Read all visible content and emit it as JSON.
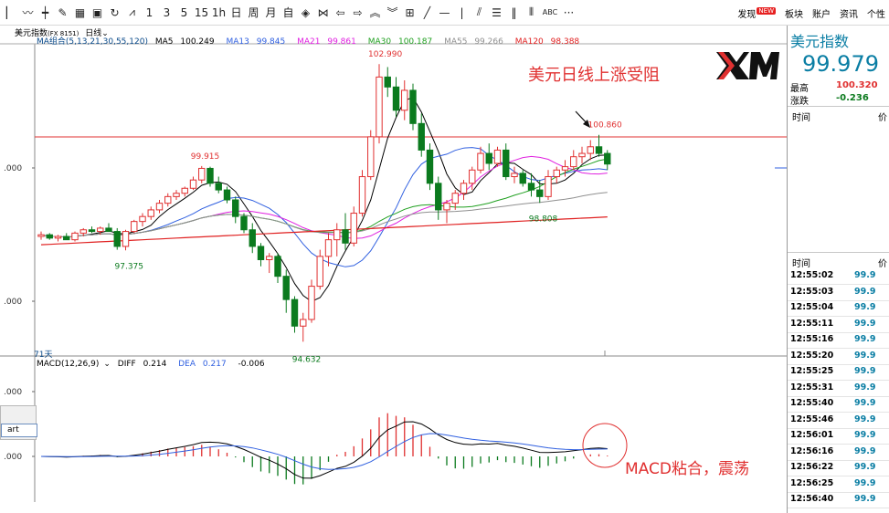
{
  "toolbar": {
    "icons": [
      "line-tool",
      "trend-line",
      "candle-tool",
      "draw-tool",
      "grid-tool",
      "save-tool",
      "refresh-tool",
      "measure-tool"
    ],
    "periods": [
      "1",
      "3",
      "5",
      "15",
      "1h",
      "日",
      "周",
      "月",
      "自"
    ],
    "right_items": [
      "发现",
      "板块",
      "账户",
      "资讯",
      "个性"
    ],
    "new_badge": "NEW",
    "abc_label": "ABC",
    "more_label": "···"
  },
  "chart_header": {
    "symbol": "美元指数",
    "code": "(FX 8151)",
    "period": "日线",
    "ma_group": "MA组合(5,13,21,30,55,120)",
    "ma": [
      {
        "label": "MA5",
        "value": "100.249",
        "color": "#000000"
      },
      {
        "label": "MA13",
        "value": "99.845",
        "color": "#3060e0"
      },
      {
        "label": "MA21",
        "value": "99.861",
        "color": "#e020e0"
      },
      {
        "label": "MA30",
        "value": "100.187",
        "color": "#20a020"
      },
      {
        "label": "MA55",
        "value": "99.266",
        "color": "#909090"
      },
      {
        "label": "MA120",
        "value": "98.388",
        "color": "#e02020"
      }
    ]
  },
  "annotations": {
    "headline": "美元日线上涨受阻",
    "macd_note": "MACD粘合，震荡",
    "logo": "XM",
    "days_label": "71天",
    "overlay_btn": "art"
  },
  "chart_data": {
    "type": "candlestick",
    "price_labels": [
      {
        "text": "99.915",
        "kind": "high"
      },
      {
        "text": "97.375",
        "kind": "low"
      },
      {
        "text": "102.990",
        "kind": "high"
      },
      {
        "text": "94.632",
        "kind": "low"
      },
      {
        "text": "100.860",
        "kind": "high"
      },
      {
        "text": "98.808",
        "kind": "low"
      }
    ],
    "y_axis_ticks": [
      ".000",
      ".000",
      ".000",
      ".000"
    ],
    "resistance_line": 100.86,
    "macd": {
      "label": "MACD(12,26,9)",
      "diff_label": "DIFF",
      "diff": "0.214",
      "dea_label": "DEA",
      "dea": "0.217",
      "macd_value": "-0.006"
    },
    "candles": [
      [
        97.8,
        97.95,
        97.7,
        97.85
      ],
      [
        97.85,
        97.9,
        97.7,
        97.75
      ],
      [
        97.75,
        97.85,
        97.65,
        97.8
      ],
      [
        97.8,
        97.9,
        97.7,
        97.7
      ],
      [
        97.7,
        97.95,
        97.65,
        97.9
      ],
      [
        97.9,
        98.05,
        97.8,
        98.0
      ],
      [
        98.0,
        98.1,
        97.9,
        97.95
      ],
      [
        97.95,
        98.1,
        97.85,
        98.05
      ],
      [
        98.05,
        98.2,
        97.95,
        97.95
      ],
      [
        97.95,
        98.05,
        97.4,
        97.5
      ],
      [
        97.5,
        98.0,
        97.38,
        97.95
      ],
      [
        97.95,
        98.3,
        97.9,
        98.25
      ],
      [
        98.25,
        98.5,
        98.1,
        98.4
      ],
      [
        98.4,
        98.7,
        98.3,
        98.6
      ],
      [
        98.6,
        98.9,
        98.5,
        98.8
      ],
      [
        98.8,
        99.1,
        98.7,
        99.0
      ],
      [
        99.0,
        99.2,
        98.9,
        99.1
      ],
      [
        99.1,
        99.3,
        99.0,
        99.25
      ],
      [
        99.25,
        99.6,
        99.2,
        99.5
      ],
      [
        99.5,
        99.92,
        99.4,
        99.85
      ],
      [
        99.85,
        99.9,
        99.3,
        99.4
      ],
      [
        99.4,
        99.6,
        99.1,
        99.2
      ],
      [
        99.2,
        99.3,
        98.8,
        98.9
      ],
      [
        98.9,
        99.0,
        98.2,
        98.4
      ],
      [
        98.4,
        98.5,
        97.9,
        98.0
      ],
      [
        98.0,
        98.2,
        97.3,
        97.5
      ],
      [
        97.5,
        97.6,
        96.9,
        97.1
      ],
      [
        97.1,
        97.3,
        96.7,
        97.2
      ],
      [
        97.2,
        97.3,
        96.4,
        96.6
      ],
      [
        96.6,
        96.8,
        95.5,
        95.9
      ],
      [
        95.9,
        96.0,
        94.9,
        95.1
      ],
      [
        95.1,
        95.5,
        94.63,
        95.3
      ],
      [
        95.3,
        96.5,
        95.2,
        96.3
      ],
      [
        96.3,
        97.4,
        96.2,
        97.2
      ],
      [
        97.2,
        97.9,
        96.9,
        97.7
      ],
      [
        97.7,
        98.2,
        97.2,
        98.0
      ],
      [
        98.0,
        98.5,
        97.4,
        97.6
      ],
      [
        97.6,
        98.7,
        97.5,
        98.5
      ],
      [
        98.5,
        99.8,
        98.4,
        99.6
      ],
      [
        99.6,
        101.0,
        99.5,
        100.8
      ],
      [
        100.8,
        102.99,
        100.6,
        102.6
      ],
      [
        102.6,
        102.9,
        102.0,
        102.3
      ],
      [
        102.3,
        102.6,
        101.4,
        101.6
      ],
      [
        101.6,
        102.5,
        101.3,
        102.2
      ],
      [
        102.2,
        102.4,
        101.0,
        101.2
      ],
      [
        101.2,
        101.5,
        100.2,
        100.4
      ],
      [
        100.4,
        100.6,
        99.2,
        99.4
      ],
      [
        99.4,
        99.6,
        98.3,
        98.6
      ],
      [
        98.6,
        98.9,
        98.2,
        98.8
      ],
      [
        98.8,
        99.2,
        98.6,
        99.1
      ],
      [
        99.1,
        99.5,
        98.9,
        99.4
      ],
      [
        99.4,
        99.9,
        99.2,
        99.8
      ],
      [
        99.8,
        100.5,
        99.7,
        100.3
      ],
      [
        100.3,
        100.6,
        99.8,
        100.0
      ],
      [
        100.0,
        100.5,
        99.9,
        100.4
      ],
      [
        100.4,
        100.6,
        99.5,
        99.6
      ],
      [
        99.6,
        99.9,
        99.4,
        99.7
      ],
      [
        99.7,
        99.8,
        99.3,
        99.4
      ],
      [
        99.4,
        99.7,
        99.0,
        99.2
      ],
      [
        99.2,
        99.5,
        98.81,
        99.0
      ],
      [
        99.0,
        99.8,
        98.9,
        99.6
      ],
      [
        99.6,
        99.9,
        99.4,
        99.8
      ],
      [
        99.8,
        100.1,
        99.6,
        99.9
      ],
      [
        99.9,
        100.4,
        99.8,
        100.2
      ],
      [
        100.2,
        100.5,
        100.0,
        100.3
      ],
      [
        100.3,
        100.7,
        100.1,
        100.5
      ],
      [
        100.5,
        100.86,
        100.2,
        100.3
      ],
      [
        100.3,
        100.4,
        99.8,
        99.98
      ]
    ]
  },
  "side_panel": {
    "title": "美元指数",
    "price": "99.979",
    "high_label": "最高",
    "high_value": "100.320",
    "change_label": "涨跌",
    "change_value": "-0.236",
    "time_header": "时间",
    "price_header": "价",
    "ticks": [
      {
        "time": "12:55:02",
        "price": "99.9"
      },
      {
        "time": "12:55:03",
        "price": "99.9"
      },
      {
        "time": "12:55:04",
        "price": "99.9"
      },
      {
        "time": "12:55:11",
        "price": "99.9"
      },
      {
        "time": "12:55:16",
        "price": "99.9"
      },
      {
        "time": "12:55:20",
        "price": "99.9"
      },
      {
        "time": "12:55:25",
        "price": "99.9"
      },
      {
        "time": "12:55:31",
        "price": "99.9"
      },
      {
        "time": "12:55:40",
        "price": "99.9"
      },
      {
        "time": "12:55:46",
        "price": "99.9"
      },
      {
        "time": "12:56:01",
        "price": "99.9"
      },
      {
        "time": "12:56:16",
        "price": "99.9"
      },
      {
        "time": "12:56:22",
        "price": "99.9"
      },
      {
        "time": "12:56:25",
        "price": "99.9"
      },
      {
        "time": "12:56:40",
        "price": "99.9"
      }
    ]
  },
  "colors": {
    "up": "#e03030",
    "down": "#0b7a1e",
    "headline": "#e03030",
    "accent": "#0a7ea4"
  }
}
